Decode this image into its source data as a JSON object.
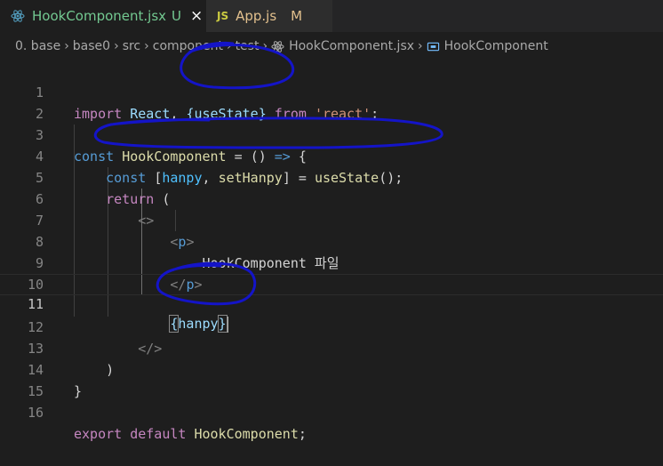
{
  "tabs": [
    {
      "label": "HookComponent.jsx",
      "status": "U",
      "close": "×",
      "icon": "react-icon"
    },
    {
      "label": "App.js",
      "status": "M",
      "icon": "js-icon",
      "icon_text": "JS"
    }
  ],
  "breadcrumb": {
    "items": [
      "0. base",
      "base0",
      "src",
      "component",
      "test",
      "HookComponent.jsx",
      "HookComponent"
    ],
    "separator": "›"
  },
  "editor": {
    "line_numbers": [
      "1",
      "2",
      "3",
      "4",
      "5",
      "6",
      "7",
      "8",
      "9",
      "10",
      "11",
      "12",
      "13",
      "14",
      "15",
      "16"
    ],
    "current_line": "11",
    "lines": {
      "l1": {
        "import": "import",
        "react": "React",
        "comma": ",",
        "brace": "{useState}",
        "from": "from",
        "str": "'react'",
        "semi": ";"
      },
      "l3": {
        "const": "const",
        "name": "HookComponent",
        "eq": "=",
        "parens": "()",
        "arrow": "=>",
        "brace": "{"
      },
      "l4": {
        "const": "const",
        "lb": "[",
        "var1": "hanpy",
        "comma": ",",
        "var2": "setHanpy",
        "rb": "]",
        "eq": "=",
        "fn": "useState",
        "call": "();"
      },
      "l5": {
        "ret": "return",
        "paren": "("
      },
      "l6": {
        "frag": "<>"
      },
      "l7": {
        "lt": "<",
        "tag": "p",
        "gt": ">"
      },
      "l8": {
        "text": "HookComponent 파일"
      },
      "l9": {
        "lt": "</",
        "tag": "p",
        "gt": ">"
      },
      "l11": {
        "lb": "{",
        "var": "hanpy",
        "rb": "}"
      },
      "l12": {
        "frag": "</>"
      },
      "l13": {
        "paren": ")"
      },
      "l14": {
        "brace": "}"
      },
      "l16": {
        "export": "export",
        "default": "default",
        "name": "HookComponent",
        "semi": ";"
      }
    }
  },
  "colors": {
    "background": "#1e1e1e",
    "keyword": "#569cd6",
    "control_keyword": "#c586c0",
    "variable": "#9cdcfe",
    "function": "#dcdcaa",
    "string": "#ce9178",
    "untracked": "#73c991",
    "modified": "#e2c08d",
    "annotation": "#1010c8"
  }
}
